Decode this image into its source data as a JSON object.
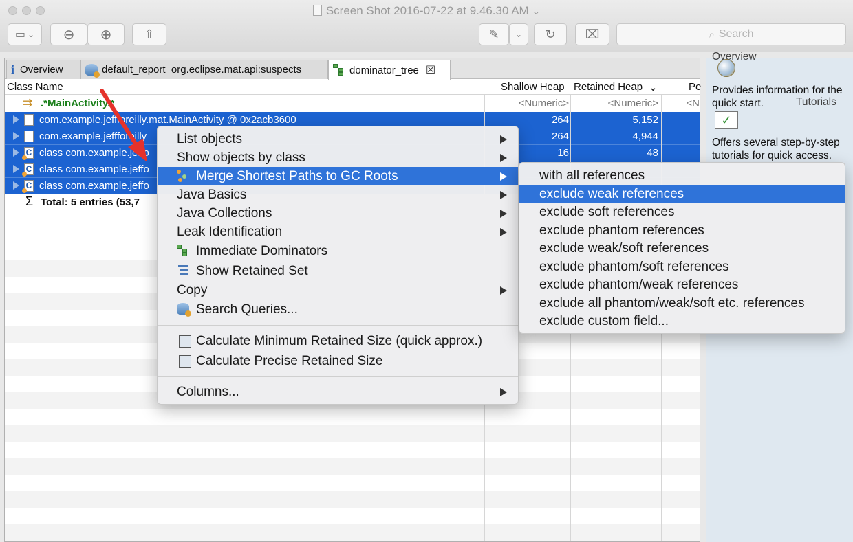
{
  "window": {
    "title": "Screen Shot 2016-07-22 at 9.46.30 AM",
    "title_chevron": "⌄",
    "search_placeholder": "Search"
  },
  "toolbar": {
    "sidebar_icon": "▭",
    "chevron": "⌄",
    "zoom_out_icon": "⊖",
    "zoom_in_icon": "⊕",
    "share_icon": "⇧",
    "markup_icon": "✎",
    "rotate_icon": "↻",
    "toolbox_icon": "⌧"
  },
  "tabs": [
    {
      "label": "Overview"
    },
    {
      "label": "default_report  org.eclipse.mat.api:suspects"
    },
    {
      "label": "dominator_tree",
      "close": "☒"
    }
  ],
  "columns": {
    "class_name": "Class Name",
    "shallow_heap": "Shallow Heap",
    "retained_heap": "Retained Heap",
    "retained_sort_icon": "⌄",
    "percent": "Pe"
  },
  "filter_row": {
    "name": ".*MainActivity.*",
    "shallow": "<Numeric>",
    "retained": "<Numeric>",
    "percent": "<N"
  },
  "rows": [
    {
      "name": "com.example.jeffforeilly.mat.MainActivity @ 0x2acb3600",
      "shallow": "264",
      "retained": "5,152"
    },
    {
      "name": "com.example.jeffforeilly",
      "shallow": "264",
      "retained": "4,944"
    },
    {
      "name": "class com.example.jeffo",
      "shallow": "16",
      "retained": "48"
    },
    {
      "name": "class com.example.jeffo",
      "shallow": "",
      "retained": ""
    },
    {
      "name": "class com.example.jeffo",
      "shallow": "",
      "retained": ""
    }
  ],
  "total_row": {
    "sigma": "Σ",
    "label": "Total: 5 entries (53,7"
  },
  "right_pane": {
    "cut_text": "Overview",
    "desc1": "Provides information for the quick start.",
    "heading2": "Tutorials",
    "desc2": "Offers several step-by-step tutorials for quick access."
  },
  "context_menu": {
    "items": [
      {
        "label": "List objects",
        "submenu": true
      },
      {
        "label": "Show objects by class",
        "submenu": true
      },
      {
        "label": "Merge Shortest Paths to GC Roots",
        "submenu": true,
        "highlighted": true
      },
      {
        "label": "Java Basics",
        "submenu": true
      },
      {
        "label": "Java Collections",
        "submenu": true
      },
      {
        "label": "Leak Identification",
        "submenu": true
      },
      {
        "label": "Immediate Dominators",
        "submenu": false
      },
      {
        "label": "Show Retained Set",
        "submenu": false
      },
      {
        "label": "Copy",
        "submenu": true
      },
      {
        "label": "Search Queries...",
        "submenu": false
      },
      {
        "label": "Calculate Minimum Retained Size (quick approx.)",
        "submenu": false
      },
      {
        "label": "Calculate Precise Retained Size",
        "submenu": false
      },
      {
        "label": "Columns...",
        "submenu": true
      }
    ]
  },
  "submenu": {
    "items": [
      {
        "label": "with all references"
      },
      {
        "label": "exclude weak references",
        "highlighted": true
      },
      {
        "label": "exclude soft references"
      },
      {
        "label": "exclude phantom references"
      },
      {
        "label": "exclude weak/soft references"
      },
      {
        "label": "exclude phantom/soft references"
      },
      {
        "label": "exclude phantom/weak references"
      },
      {
        "label": "exclude all phantom/weak/soft etc. references"
      },
      {
        "label": "exclude custom field..."
      }
    ]
  },
  "colors": {
    "selection": "#1c63d1",
    "menu_highlight": "#2f73d9",
    "annotation_arrow": "#e5322b",
    "filter_text": "#1a7f1a"
  }
}
